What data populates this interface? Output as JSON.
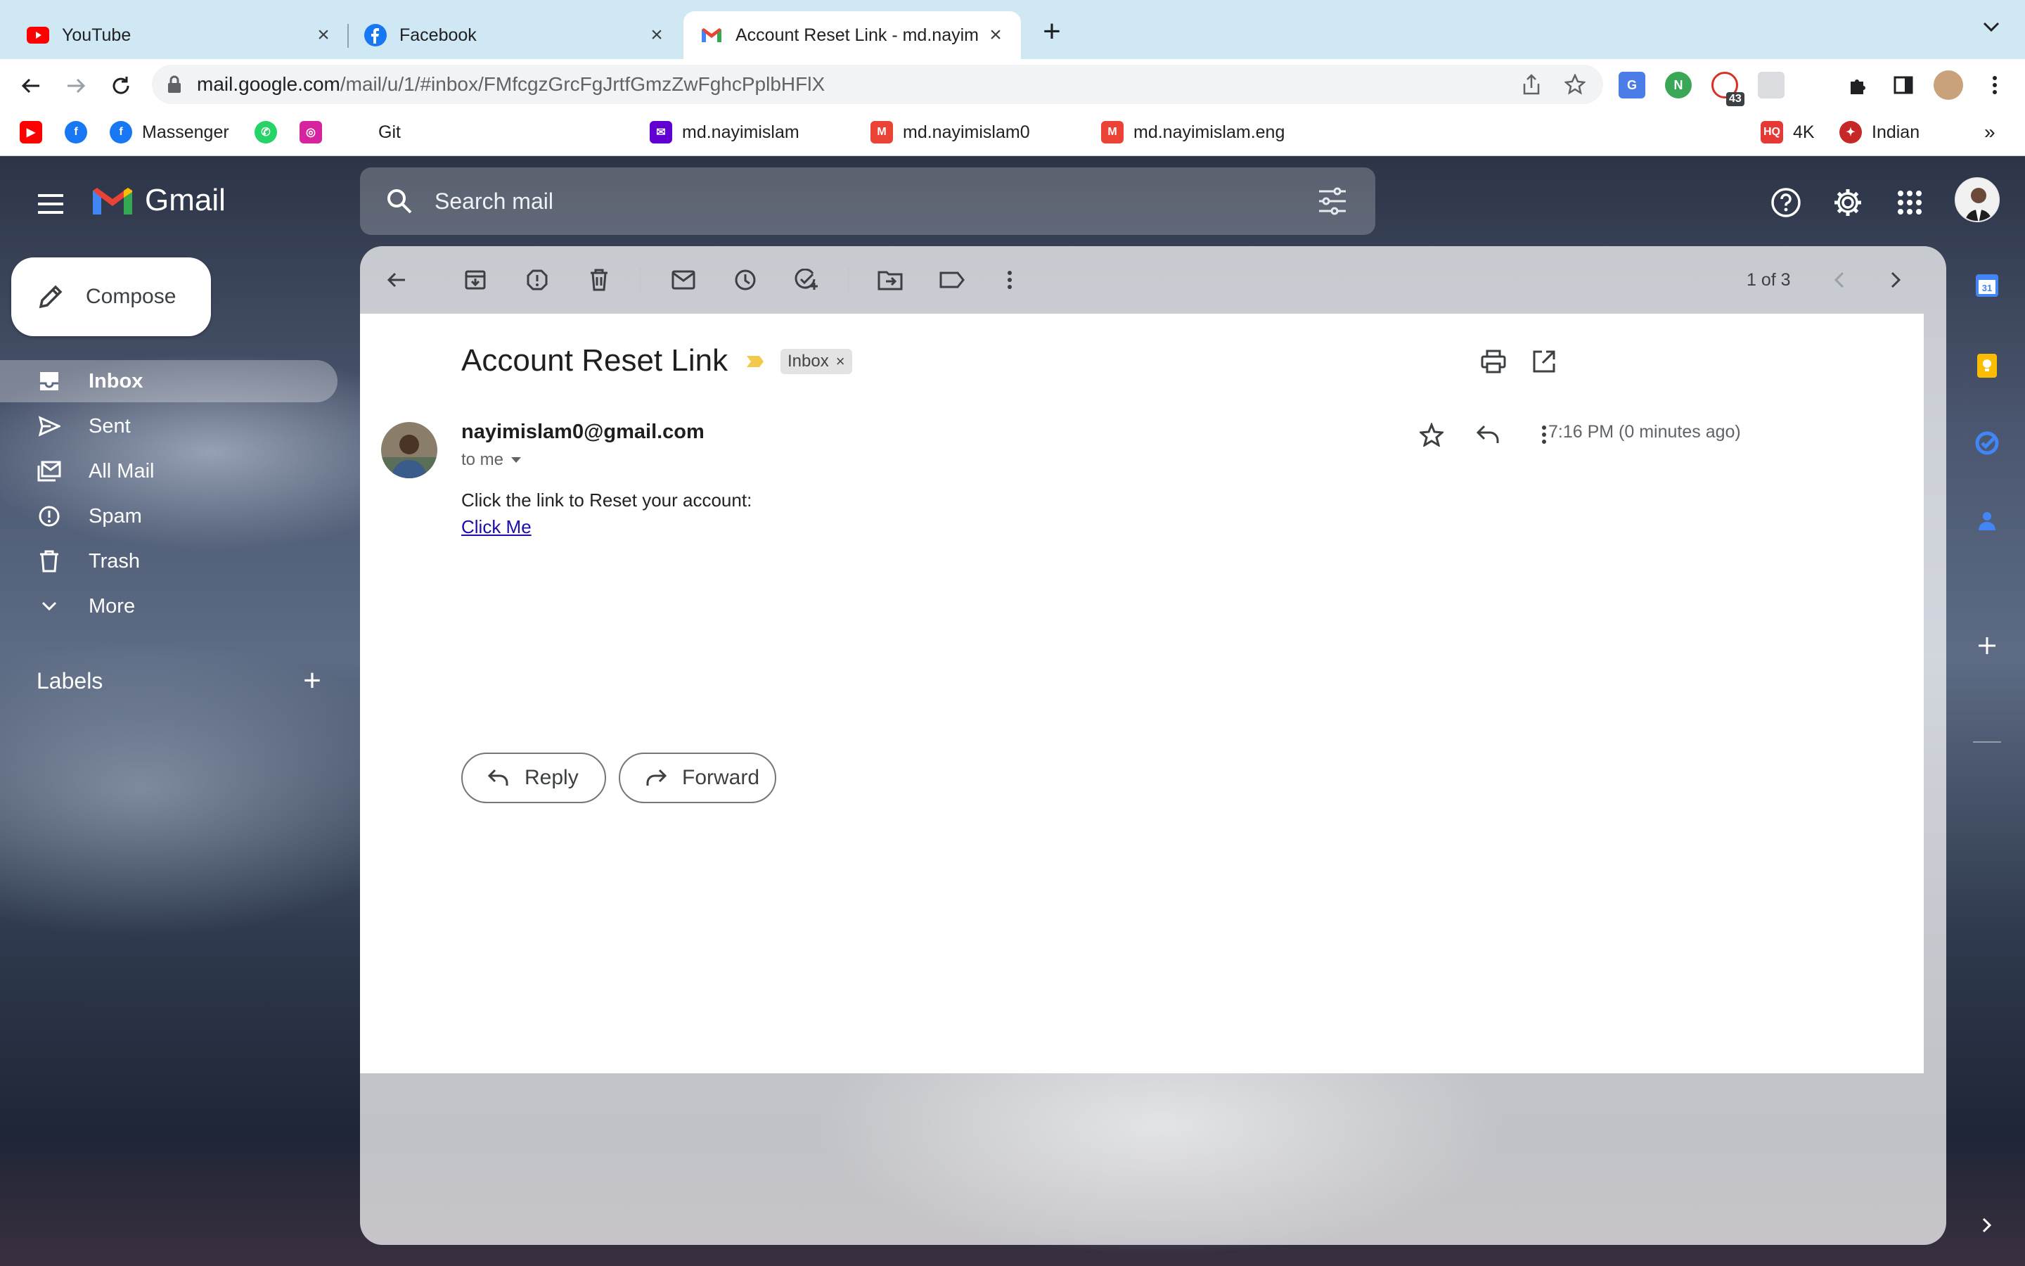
{
  "browser": {
    "tabs": [
      {
        "title": "YouTube",
        "favicon": "youtube-icon"
      },
      {
        "title": "Facebook",
        "favicon": "facebook-icon"
      },
      {
        "title": "Account Reset Link - md.nayim",
        "favicon": "gmail-icon",
        "active": true
      }
    ],
    "url": {
      "host": "mail.google.com",
      "path": "/mail/u/1/#inbox/FMfcgzGrcFgJrtfGmzZwFghcPplbHFlX"
    },
    "extension_badge": "43",
    "bookmarks": [
      {
        "label": "",
        "icon": "youtube-icon"
      },
      {
        "label": "",
        "icon": "facebook-icon"
      },
      {
        "label": "Massenger",
        "icon": "facebook-icon"
      },
      {
        "label": "",
        "icon": "whatsapp-icon"
      },
      {
        "label": "",
        "icon": "instagram-icon"
      },
      {
        "label": "Git",
        "icon": "github-icon"
      },
      {
        "label": "md.nayimislam",
        "icon": "mail-icon"
      },
      {
        "label": "md.nayimislam0",
        "icon": "gmail-icon"
      },
      {
        "label": "md.nayimislam.eng",
        "icon": "gmail-icon"
      },
      {
        "label": "4K",
        "icon": "hq-icon"
      },
      {
        "label": "Indian",
        "icon": "bookmark-icon"
      }
    ]
  },
  "gmail": {
    "product_name": "Gmail",
    "search_placeholder": "Search mail",
    "compose_label": "Compose",
    "nav": [
      {
        "label": "Inbox",
        "icon": "inbox-icon",
        "active": true
      },
      {
        "label": "Sent",
        "icon": "send-icon"
      },
      {
        "label": "All Mail",
        "icon": "all-mail-icon"
      },
      {
        "label": "Spam",
        "icon": "spam-icon"
      },
      {
        "label": "Trash",
        "icon": "trash-icon"
      },
      {
        "label": "More",
        "icon": "chevron-down-icon"
      }
    ],
    "labels_heading": "Labels",
    "pager": "1 of 3",
    "email": {
      "subject": "Account Reset Link",
      "label_chip": "Inbox",
      "sender": "nayimislam0@gmail.com",
      "recipient_line": "to me",
      "time": "7:16 PM (0 minutes ago)",
      "body_line": "Click the link to Reset your account:",
      "link_text": "Click Me"
    },
    "actions": {
      "reply": "Reply",
      "forward": "Forward"
    }
  },
  "colors": {
    "accent_tab_bar": "#cfe8f3",
    "link": "#1a0dab"
  }
}
